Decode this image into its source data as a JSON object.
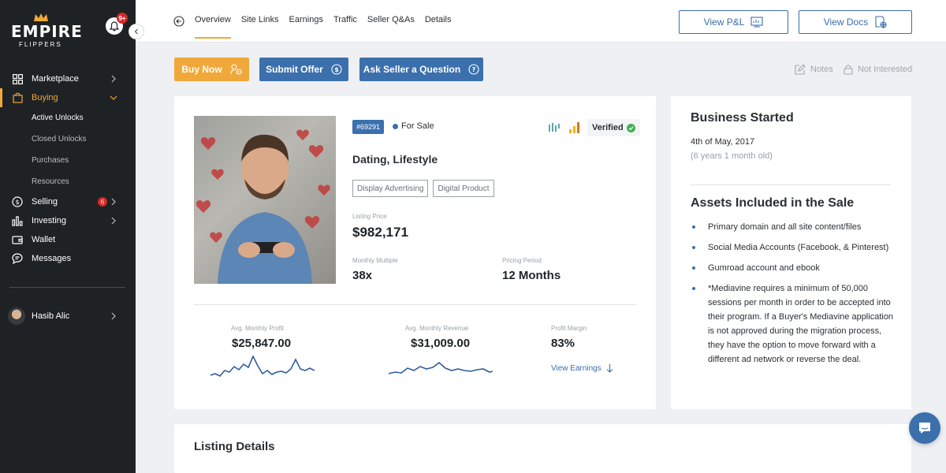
{
  "brand": {
    "name": "EMPIRE",
    "tagline": "FLIPPERS",
    "accent": "#f0a83a",
    "blue": "#3b70ad"
  },
  "notifications": {
    "count": "9+"
  },
  "sidebar": {
    "items": [
      {
        "label": "Marketplace",
        "icon": "grid-icon"
      },
      {
        "label": "Buying",
        "icon": "shopping-bag-icon",
        "active": true
      },
      {
        "label": "Selling",
        "icon": "dollar-circle-icon",
        "badge": "6"
      },
      {
        "label": "Investing",
        "icon": "bar-chart-icon"
      },
      {
        "label": "Wallet",
        "icon": "wallet-icon"
      },
      {
        "label": "Messages",
        "icon": "chat-bubble-icon"
      }
    ],
    "buying_sub": [
      "Active Unlocks",
      "Closed Unlocks",
      "Purchases",
      "Resources"
    ],
    "user": "Hasib Alic"
  },
  "tabs": [
    "Overview",
    "Site Links",
    "Earnings",
    "Traffic",
    "Seller Q&As",
    "Details"
  ],
  "top_buttons": {
    "pl": "View P&L",
    "docs": "View Docs"
  },
  "actions": {
    "buy": "Buy Now",
    "offer": "Submit Offer",
    "ask": "Ask Seller a Question",
    "notes": "Notes",
    "not_interested": "Not Interested"
  },
  "listing": {
    "id": "#69291",
    "status": "For Sale",
    "verified": "Verified",
    "niche": "Dating, Lifestyle",
    "tags": [
      "Display Advertising",
      "Digital Product"
    ],
    "price_label": "Listing Price",
    "price": "$982,171",
    "multiple_label": "Monthly Multiple",
    "multiple": "38x",
    "period_label": "Pricing Period",
    "period": "12 Months",
    "profit_label": "Avg. Monthly Profit",
    "profit": "$25,847.00",
    "revenue_label": "Avg. Monthly Revenue",
    "revenue": "$31,009.00",
    "margin_label": "Profit Margin",
    "margin": "83%",
    "view_earnings": "View Earnings"
  },
  "business": {
    "title": "Business Started",
    "date": "4th of May, 2017",
    "age": "(6 years 1 month old)"
  },
  "assets": {
    "title": "Assets Included in the Sale",
    "items": [
      "Primary domain and all site content/files",
      "Social Media Accounts (Facebook, & Pinterest)",
      "Gumroad account and ebook",
      "*Mediavine requires a minimum of 50,000 sessions per month in order to be accepted into their program. If a Buyer's Mediavine application is not approved during the migration process, they have the option to move forward with a different ad network or reverse the deal."
    ]
  },
  "details": {
    "title": "Listing Details"
  }
}
